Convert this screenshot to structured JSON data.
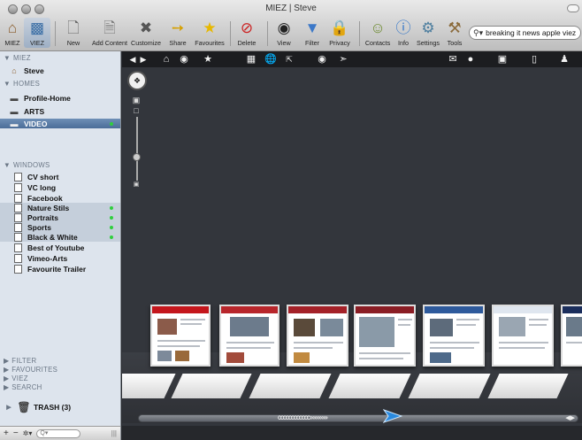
{
  "window": {
    "title": "MIEZ | Steve"
  },
  "toolbar": {
    "buttons": [
      {
        "id": "miez",
        "label": "MIEZ",
        "icon": "home-icon"
      },
      {
        "id": "viez",
        "label": "VIEZ",
        "icon": "viez-icon"
      },
      {
        "id": "new",
        "label": "New",
        "icon": "new-document-icon"
      },
      {
        "id": "add",
        "label": "Add Content",
        "icon": "add-content-icon"
      },
      {
        "id": "customize",
        "label": "Customize",
        "icon": "tools-cross-icon"
      },
      {
        "id": "share",
        "label": "Share",
        "icon": "share-icon"
      },
      {
        "id": "favourites",
        "label": "Favourites",
        "icon": "star-icon"
      },
      {
        "id": "delete",
        "label": "Delete",
        "icon": "delete-icon"
      },
      {
        "id": "view",
        "label": "View",
        "icon": "binoculars-icon"
      },
      {
        "id": "filter",
        "label": "Filter",
        "icon": "filter-icon"
      },
      {
        "id": "privacy",
        "label": "Privacy",
        "icon": "lock-icon"
      },
      {
        "id": "contacts",
        "label": "Contacts",
        "icon": "contacts-icon"
      },
      {
        "id": "info",
        "label": "Info",
        "icon": "info-icon"
      },
      {
        "id": "settings",
        "label": "Settings",
        "icon": "gear-icon"
      },
      {
        "id": "tools",
        "label": "Tools",
        "icon": "tools-icon"
      }
    ],
    "search_value": "breaking it news apple viez"
  },
  "sidebar": {
    "miez_header": "MIEZ",
    "user": "Steve",
    "homes_header": "HOMES",
    "homes": [
      {
        "label": "Profile-Home"
      },
      {
        "label": "ARTS"
      },
      {
        "label": "VIDEO",
        "selected": true,
        "active": true
      }
    ],
    "windows_header": "WINDOWS",
    "windows": [
      {
        "label": "CV short"
      },
      {
        "label": "VC long"
      },
      {
        "label": "Facebook"
      },
      {
        "label": "Nature Stils",
        "group": true,
        "active": true
      },
      {
        "label": "Portraits",
        "group": true,
        "active": true
      },
      {
        "label": "Sports",
        "group": true,
        "active": true
      },
      {
        "label": "Black & White",
        "group": true,
        "active": true
      },
      {
        "label": "Best of Youtube"
      },
      {
        "label": "Vimeo-Arts"
      },
      {
        "label": "Favourite Trailer"
      }
    ],
    "bottom_sections": [
      "FILTER",
      "FAVOURITES",
      "VIEZ",
      "SEARCH"
    ],
    "trash_label": "TRASH (3)",
    "footer": {
      "add": "+",
      "remove": "−",
      "action": "✲▾",
      "filter_placeholder": "Q▾"
    }
  },
  "viewer": {
    "toolbar_icons": [
      "back-icon",
      "forward-icon",
      "home-icon",
      "record-icon",
      "star-icon",
      "grid-icon",
      "globe-icon",
      "expand-icon",
      "download-icon",
      "compass-icon",
      "mail-icon",
      "chat-icon",
      "camera-icon",
      "clipboard-icon",
      "user-icon"
    ],
    "thumbnails": [
      {
        "site": "CNN",
        "header_color": "#c4161c"
      },
      {
        "site": "news",
        "header_color": "#b8262b"
      },
      {
        "site": "news",
        "header_color": "#a42128"
      },
      {
        "site": "news",
        "header_color": "#8a1d24"
      },
      {
        "site": "news",
        "header_color": "#2e5a9c"
      },
      {
        "site": "news",
        "header_color": "#dfe6ef"
      },
      {
        "site": "NDTV",
        "header_color": "#1b2e5c"
      }
    ]
  }
}
